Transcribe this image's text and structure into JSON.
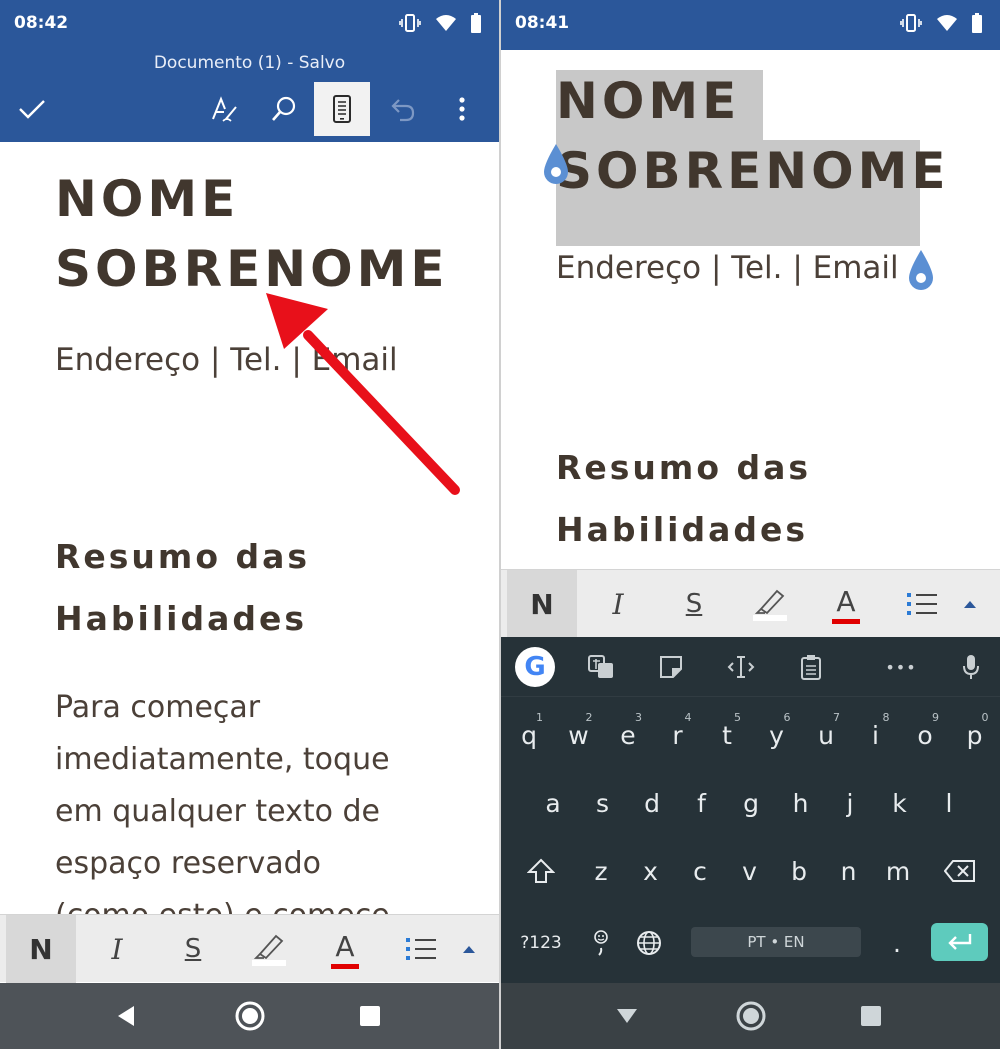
{
  "left": {
    "status": {
      "time": "08:42"
    },
    "header": {
      "title": "Documento (1) - Salvo"
    },
    "document": {
      "name_line1": "NOME",
      "name_line2": "SOBRENOME",
      "contact": "Endereço | Tel. | Email",
      "section_line1": "Resumo das",
      "section_line2": "Habilidades",
      "body_lines": [
        "Para começar",
        "imediatamente, toque",
        "em qualquer texto de",
        "espaço reservado",
        "(como este) e comece"
      ]
    },
    "format_bar": {
      "bold": "N",
      "italic": "I",
      "underline": "S",
      "font_color": "A"
    }
  },
  "right": {
    "status": {
      "time": "08:41"
    },
    "document": {
      "name_line1": "NOME",
      "name_line2": "SOBRENOME",
      "contact": "Endereço | Tel. | Email",
      "section_line1": "Resumo das",
      "section_line2": "Habilidades"
    },
    "format_bar": {
      "bold": "N",
      "italic": "I",
      "underline": "S",
      "font_color": "A"
    },
    "keyboard": {
      "row1": [
        "q",
        "w",
        "e",
        "r",
        "t",
        "y",
        "u",
        "i",
        "o",
        "p"
      ],
      "row1_hints": [
        "1",
        "2",
        "3",
        "4",
        "5",
        "6",
        "7",
        "8",
        "9",
        "0"
      ],
      "row2": [
        "a",
        "s",
        "d",
        "f",
        "g",
        "h",
        "j",
        "k",
        "l"
      ],
      "row3": [
        "z",
        "x",
        "c",
        "v",
        "b",
        "n",
        "m"
      ],
      "symbols_key": "?123",
      "space_label": "PT • EN",
      "period": ".",
      "suggest_more": "•••",
      "google": "G"
    }
  },
  "colors": {
    "word_blue": "#2b579a",
    "selection": "#c8c8c8",
    "handle_blue": "#5b8fd3",
    "font_color_red": "#e00000",
    "enter_teal": "#5ecbbd",
    "arrow_red": "#e8101a"
  }
}
